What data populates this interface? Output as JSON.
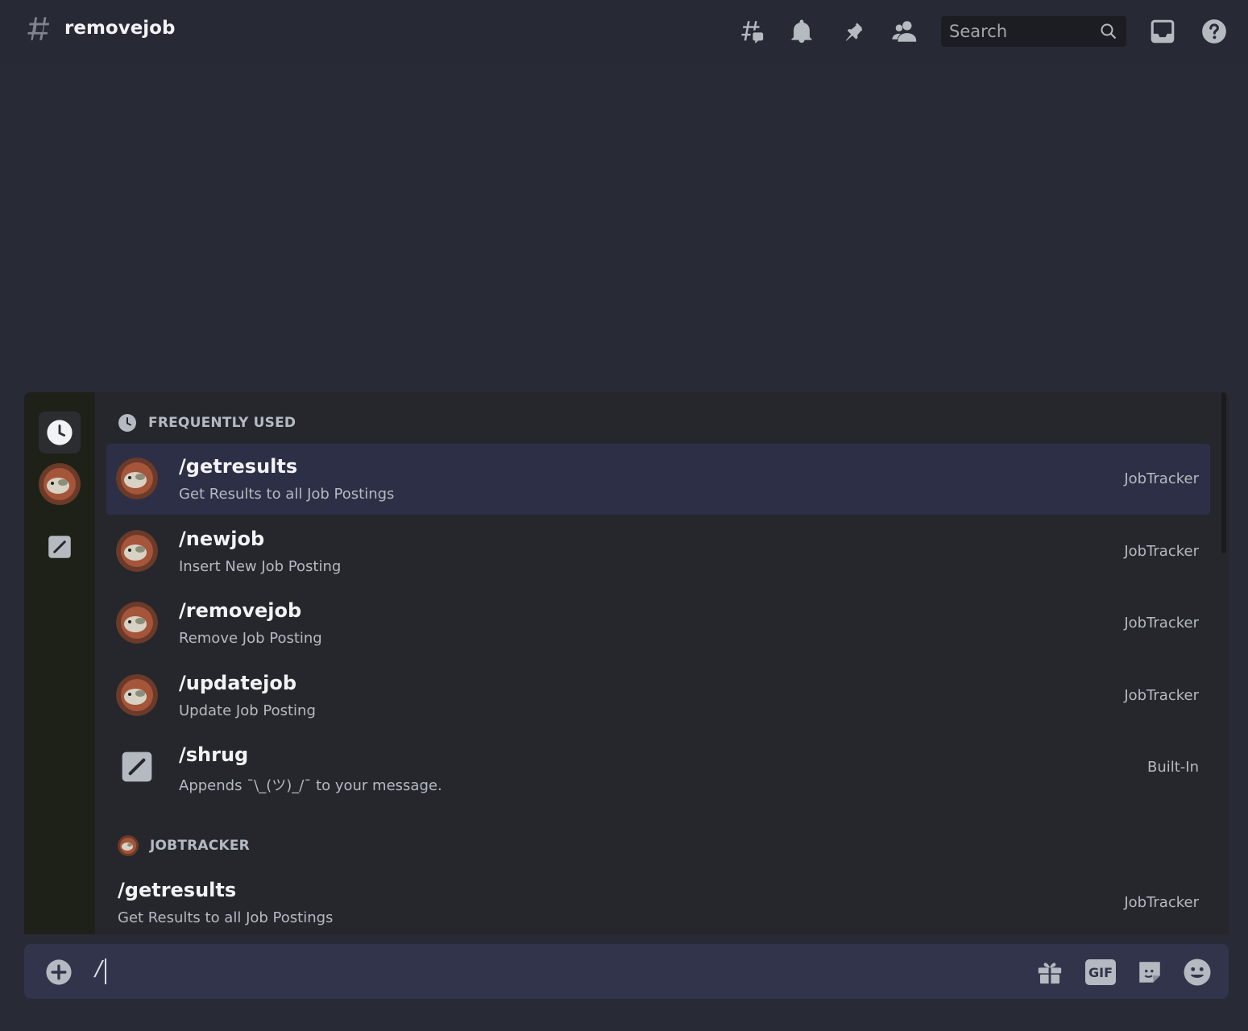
{
  "header": {
    "channel_name": "removejob",
    "search_placeholder": "Search"
  },
  "autocomplete": {
    "sections": [
      {
        "title": "FREQUENTLY USED",
        "commands": [
          {
            "name": "/getresults",
            "description": "Get Results to all Job Postings",
            "source": "JobTracker"
          },
          {
            "name": "/newjob",
            "description": "Insert New Job Posting",
            "source": "JobTracker"
          },
          {
            "name": "/removejob",
            "description": "Remove Job Posting",
            "source": "JobTracker"
          },
          {
            "name": "/updatejob",
            "description": "Update Job Posting",
            "source": "JobTracker"
          },
          {
            "name": "/shrug",
            "description": "Appends ¯\\_(ツ)_/¯ to your message.",
            "source": "Built-In"
          }
        ]
      },
      {
        "title": "JOBTRACKER",
        "commands": [
          {
            "name": "/getresults",
            "description": "Get Results to all Job Postings",
            "source": "JobTracker"
          }
        ]
      }
    ]
  },
  "composer": {
    "value": "/",
    "gif_label": "GIF"
  },
  "colors": {
    "selected_row": "#2c2f45",
    "background": "#282a36"
  }
}
